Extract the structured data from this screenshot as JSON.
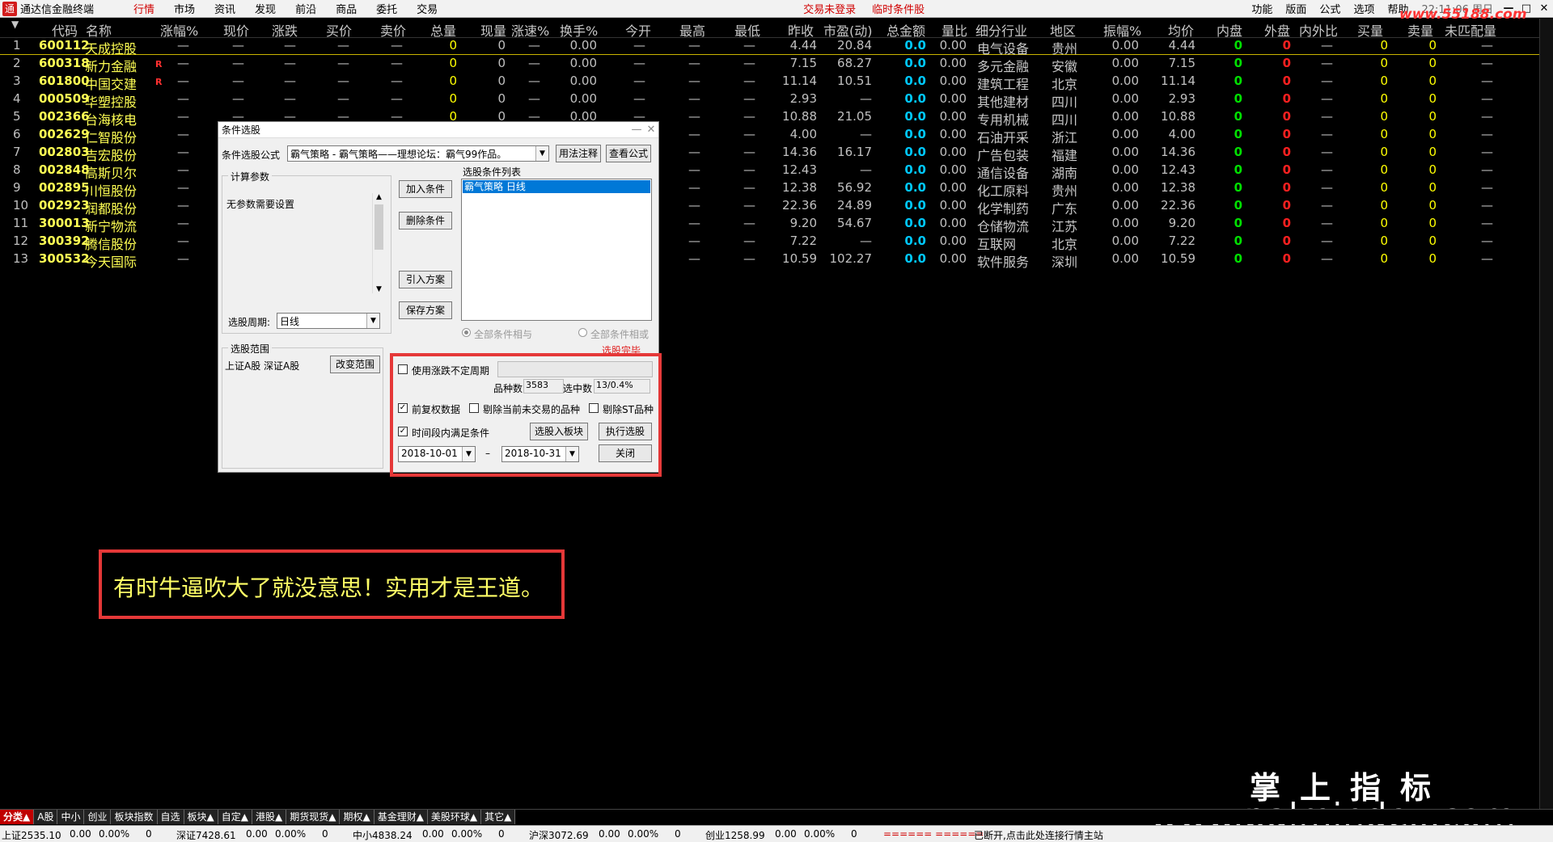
{
  "app": {
    "title": "通达信金融终端",
    "menus": [
      "行情",
      "市场",
      "资讯",
      "发现",
      "前沿",
      "商品",
      "委托",
      "交易"
    ],
    "active_menu": "行情",
    "trade_status": "交易未登录",
    "temp_screen": "临时条件股",
    "right_menus": [
      "功能",
      "版面",
      "公式",
      "选项",
      "帮助"
    ],
    "clock": "22:11:06 周日",
    "win_buttons": [
      "—",
      "□",
      "✕"
    ]
  },
  "watermark_top": "www.55188.com",
  "table": {
    "headers": [
      "代码",
      "名称",
      "涨幅%",
      "现价",
      "涨跌",
      "买价",
      "卖价",
      "总量",
      "现量",
      "涨速%",
      "换手%",
      "今开",
      "最高",
      "最低",
      "昨收",
      "市盈(动)",
      "总金额",
      "量比",
      "细分行业",
      "地区",
      "振幅%",
      "均价",
      "内盘",
      "外盘",
      "内外比",
      "买量",
      "卖量",
      "未匹配量"
    ],
    "rows": [
      {
        "n": "1",
        "code": "600112",
        "name": "天成控股",
        "flag": "",
        "close": "4.44",
        "pe": "20.84",
        "ind": "电气设备",
        "area": "贵州",
        "avg": "4.44"
      },
      {
        "n": "2",
        "code": "600318",
        "name": "新力金融",
        "flag": "R",
        "close": "7.15",
        "pe": "68.27",
        "ind": "多元金融",
        "area": "安徽",
        "avg": "7.15"
      },
      {
        "n": "3",
        "code": "601800",
        "name": "中国交建",
        "flag": "R",
        "close": "11.14",
        "pe": "10.51",
        "ind": "建筑工程",
        "area": "北京",
        "avg": "11.14"
      },
      {
        "n": "4",
        "code": "000509",
        "name": "华塑控股",
        "flag": "",
        "close": "2.93",
        "pe": "—",
        "ind": "其他建材",
        "area": "四川",
        "avg": "2.93"
      },
      {
        "n": "5",
        "code": "002366",
        "name": "台海核电",
        "flag": "",
        "close": "10.88",
        "pe": "21.05",
        "ind": "专用机械",
        "area": "四川",
        "avg": "10.88"
      },
      {
        "n": "6",
        "code": "002629",
        "name": "仁智股份",
        "flag": "",
        "close": "4.00",
        "pe": "—",
        "ind": "石油开采",
        "area": "浙江",
        "avg": "4.00"
      },
      {
        "n": "7",
        "code": "002803",
        "name": "吉宏股份",
        "flag": "",
        "close": "14.36",
        "pe": "16.17",
        "ind": "广告包装",
        "area": "福建",
        "avg": "14.36"
      },
      {
        "n": "8",
        "code": "002848",
        "name": "高斯贝尔",
        "flag": "",
        "close": "12.43",
        "pe": "—",
        "ind": "通信设备",
        "area": "湖南",
        "avg": "12.43"
      },
      {
        "n": "9",
        "code": "002895",
        "name": "川恒股份",
        "flag": "",
        "close": "12.38",
        "pe": "56.92",
        "ind": "化工原料",
        "area": "贵州",
        "avg": "12.38"
      },
      {
        "n": "10",
        "code": "002923",
        "name": "润都股份",
        "flag": "",
        "close": "22.36",
        "pe": "24.89",
        "ind": "化学制药",
        "area": "广东",
        "avg": "22.36"
      },
      {
        "n": "11",
        "code": "300013",
        "name": "新宁物流",
        "flag": "",
        "close": "9.20",
        "pe": "54.67",
        "ind": "仓储物流",
        "area": "江苏",
        "avg": "9.20"
      },
      {
        "n": "12",
        "code": "300392",
        "name": "腾信股份",
        "flag": "",
        "close": "7.22",
        "pe": "—",
        "ind": "互联网",
        "area": "北京",
        "avg": "7.22"
      },
      {
        "n": "13",
        "code": "300532",
        "name": "今天国际",
        "flag": "",
        "close": "10.59",
        "pe": "102.27",
        "ind": "软件服务",
        "area": "深圳",
        "avg": "10.59"
      }
    ],
    "dash": "—",
    "zero": "0",
    "zero_pct": "0.00",
    "amt_zero": "0.0"
  },
  "dialog": {
    "title": "条件选股",
    "formula_label": "条件选股公式",
    "formula_value": "霸气策略        - 霸气策略——理想论坛：霸气99作品。",
    "usage_btn": "用法注释",
    "view_btn": "查看公式",
    "params_group": "计算参数",
    "params_text": "无参数需要设置",
    "add_btn": "加入条件",
    "del_btn": "删除条件",
    "import_btn": "引入方案",
    "save_btn": "保存方案",
    "list_label": "选股条件列表",
    "list_item": "霸气策略   日线",
    "period_label": "选股周期:",
    "period_value": "日线",
    "and_label": "全部条件相与",
    "or_label": "全部条件相或",
    "range_group": "选股范围",
    "range_value": "上证A股  深证A股",
    "change_range_btn": "改变范围",
    "done_label": "选股完毕",
    "use_period_label": "使用涨跌不定周期",
    "count_label": "品种数",
    "count_value": "3583",
    "selected_label": "选中数",
    "selected_value": "13/0.4%",
    "fq_label": "前复权数据",
    "exclude_notrade_label": "剔除当前未交易的品种",
    "exclude_st_label": "剔除ST品种",
    "period_cond_label": "时间段内满足条件",
    "to_block_btn": "选股入板块",
    "run_btn": "执行选股",
    "close_btn": "关闭",
    "date_from": "2018-10-01",
    "date_to": "2018-10-31",
    "date_sep": "–"
  },
  "note": "有时牛逼吹大了就没意思！实用才是王道。",
  "watermark1": "掌上指标",
  "watermark2": "www.palmindex.com",
  "tabs": [
    "分类▲",
    "A股",
    "中小",
    "创业",
    "板块指数",
    "自选",
    "板块▲",
    "自定▲",
    "港股▲",
    "期货现货▲",
    "期权▲",
    "基金理财▲",
    "美股环球▲",
    "其它▲"
  ],
  "status": {
    "sh": "上证2535.10",
    "sh_chg": "0.00",
    "sh_pct": "0.00%",
    "sh_vol": "0",
    "sz": "深证7428.61",
    "sz_chg": "0.00",
    "sz_pct": "0.00%",
    "sz_vol": "0",
    "zx": "中小4838.24",
    "zx_chg": "0.00",
    "zx_pct": "0.00%",
    "zx_vol": "0",
    "hs": "沪深3072.69",
    "hs_chg": "0.00",
    "hs_pct": "0.00%",
    "hs_vol": "0",
    "cy": "创业1258.99",
    "cy_chg": "0.00",
    "cy_pct": "0.00%",
    "cy_vol": "0",
    "dashes": "====== ======",
    "conn": "已断开,点击此处连接行情主站"
  }
}
